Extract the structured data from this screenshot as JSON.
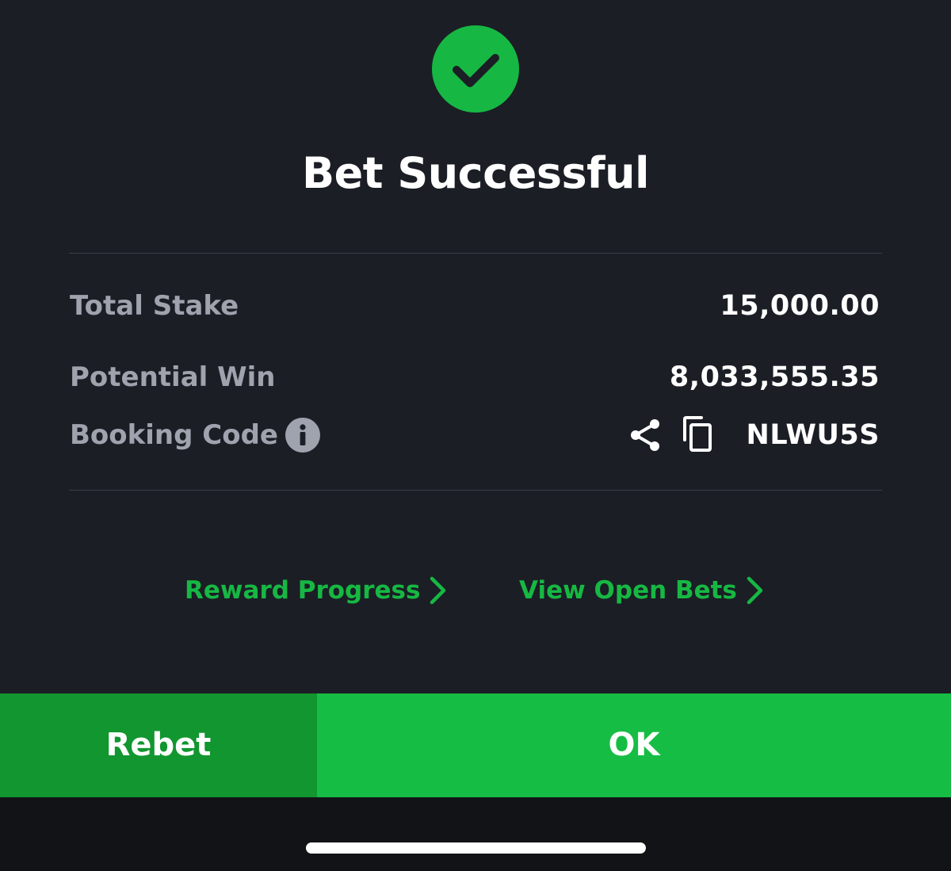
{
  "title": "Bet Successful",
  "summary": {
    "total_stake_label": "Total Stake",
    "total_stake_value": "15,000.00",
    "potential_win_label": "Potential Win",
    "potential_win_value": "8,033,555.35",
    "booking_code_label": "Booking Code",
    "booking_code_value": "NLWU5S"
  },
  "icons": {
    "status": "check-icon",
    "info": "info-icon",
    "share": "share-icon",
    "copy": "copy-icon",
    "link_arrow": "chevron-right-icon"
  },
  "links": {
    "reward_progress": "Reward Progress",
    "view_open_bets": "View Open Bets"
  },
  "buttons": {
    "rebet": "Rebet",
    "ok": "OK"
  },
  "colors": {
    "accent_green": "#16b843",
    "rebet_bg": "#12962f",
    "ok_bg": "#16bd44",
    "panel_bg": "#1b1e25"
  }
}
